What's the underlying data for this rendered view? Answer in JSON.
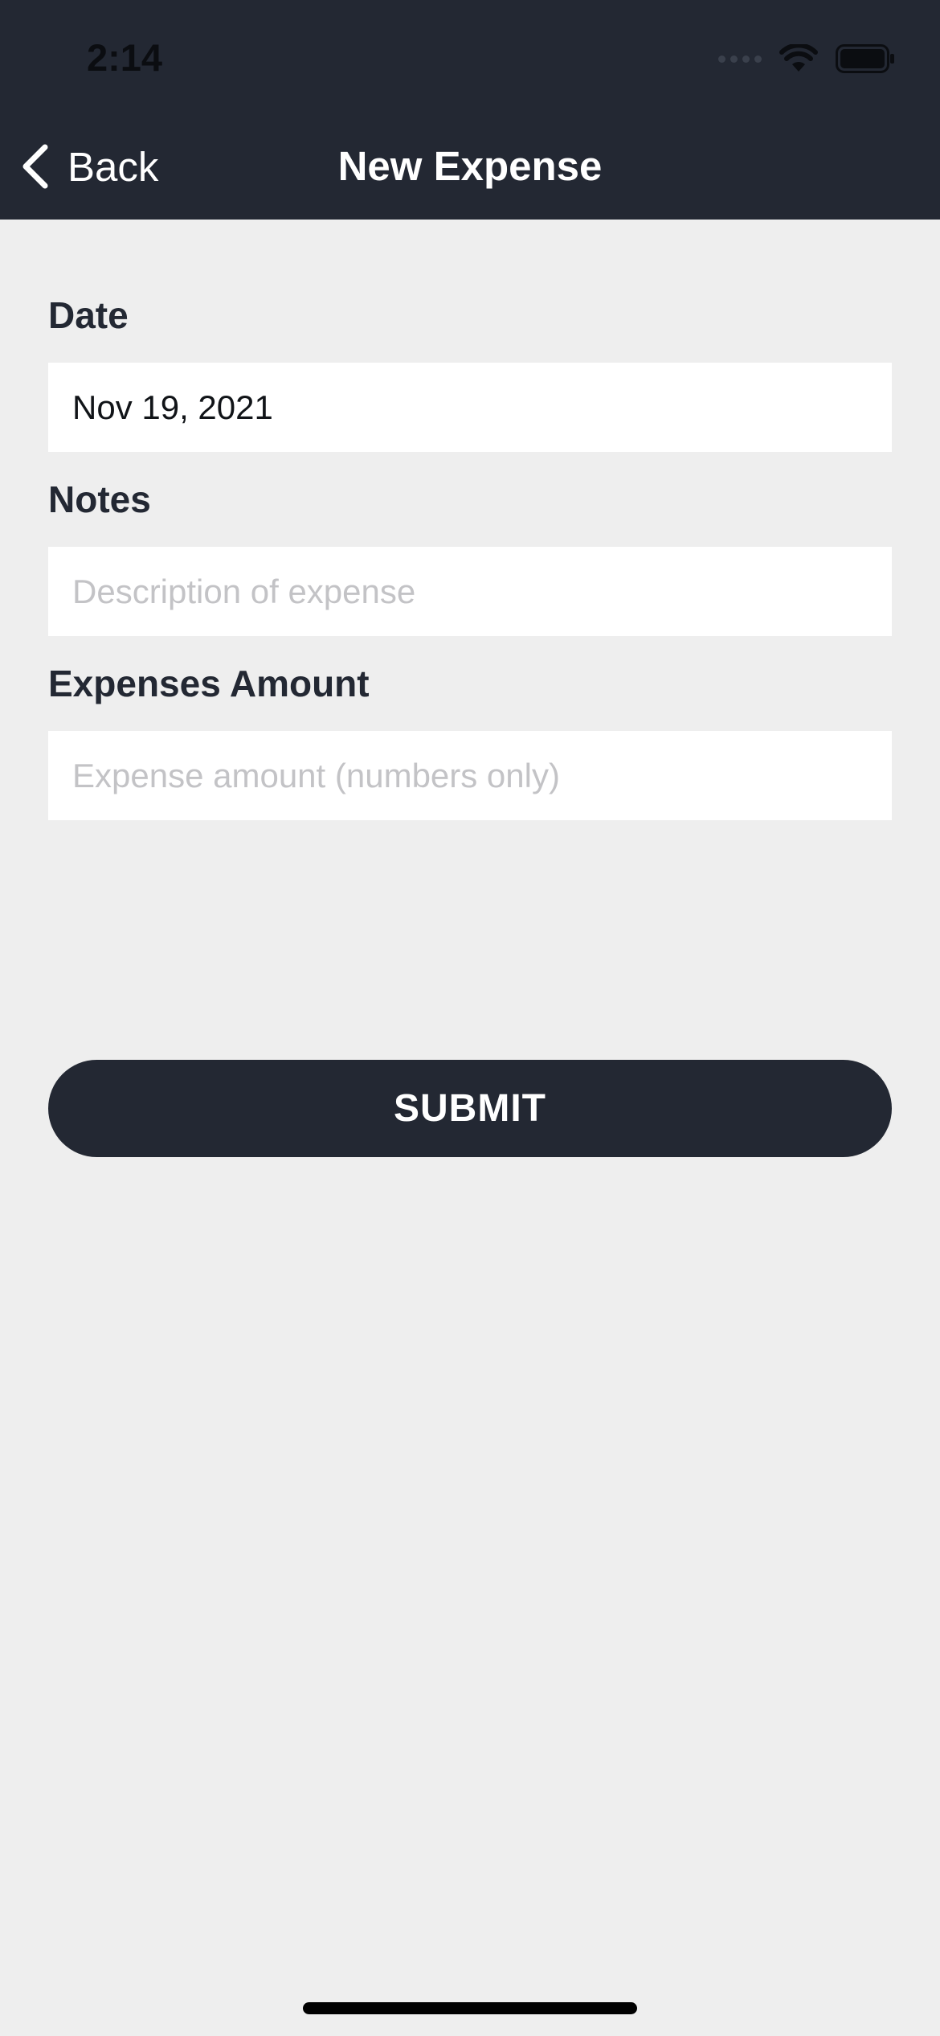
{
  "status_bar": {
    "time": "2:14",
    "icons": [
      "signal-dots-icon",
      "wifi-icon",
      "battery-icon"
    ]
  },
  "nav": {
    "back_label": "Back",
    "title": "New Expense"
  },
  "form": {
    "date": {
      "label": "Date",
      "value": "Nov 19, 2021"
    },
    "notes": {
      "label": "Notes",
      "placeholder": "Description of expense"
    },
    "amount": {
      "label": "Expenses Amount",
      "placeholder": "Expense amount (numbers only)"
    },
    "submit_label": "SUBMIT"
  },
  "colors": {
    "header_bg": "#232833",
    "page_bg": "#eeeeee",
    "button_bg": "#232833",
    "placeholder": "#c3c3c6"
  }
}
